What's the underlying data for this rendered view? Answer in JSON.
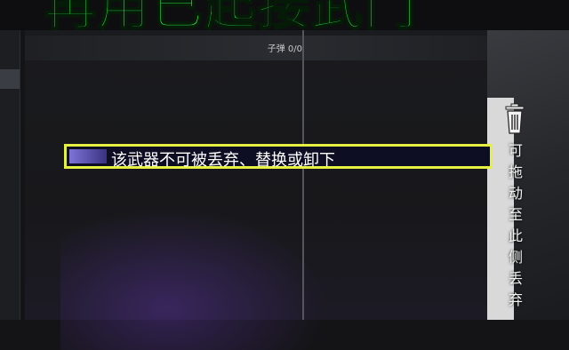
{
  "banner": {
    "title": "再用已起接武门"
  },
  "weapon_panel": {
    "ammo_label": "子弹 0/0"
  },
  "tooltip": {
    "message": "该武器不可被丢弃、替换或卸下"
  },
  "discard_zone": {
    "chars": [
      "可",
      "拖",
      "动",
      "至",
      "此",
      "侧",
      "丢",
      "弃"
    ],
    "icon": "trash-icon"
  },
  "colors": {
    "banner_green": "#2fe04a",
    "tooltip_border": "#e6f040",
    "tooltip_bg": "#0d0d24",
    "tooltip_accent": "#7d73d8"
  }
}
